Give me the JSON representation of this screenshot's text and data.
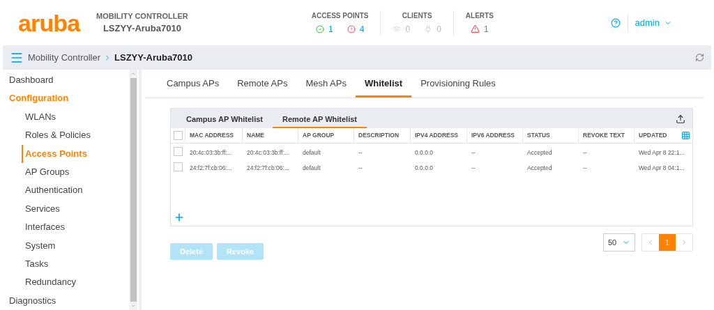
{
  "header": {
    "logo": "aruba",
    "product": "MOBILITY CONTROLLER",
    "device": "LSZYY-Aruba7010",
    "stats": [
      {
        "title": "ACCESS POINTS",
        "items": [
          {
            "kind": "up",
            "value": "1"
          },
          {
            "kind": "down",
            "value": "4"
          }
        ]
      },
      {
        "title": "CLIENTS",
        "items": [
          {
            "kind": "wireless",
            "value": "0"
          },
          {
            "kind": "wired",
            "value": "0"
          }
        ]
      },
      {
        "title": "ALERTS",
        "items": [
          {
            "kind": "alert",
            "value": "1"
          }
        ]
      }
    ],
    "user": "admin"
  },
  "breadcrumb": {
    "parent": "Mobility Controller",
    "current": "LSZYY-Aruba7010"
  },
  "sidebar": {
    "items": [
      {
        "label": "Dashboard",
        "expanded": false
      },
      {
        "label": "Configuration",
        "expanded": true,
        "children": [
          {
            "label": "WLANs",
            "selected": false
          },
          {
            "label": "Roles & Policies",
            "selected": false
          },
          {
            "label": "Access Points",
            "selected": true
          },
          {
            "label": "AP Groups",
            "selected": false
          },
          {
            "label": "Authentication",
            "selected": false
          },
          {
            "label": "Services",
            "selected": false
          },
          {
            "label": "Interfaces",
            "selected": false
          },
          {
            "label": "System",
            "selected": false
          },
          {
            "label": "Tasks",
            "selected": false
          },
          {
            "label": "Redundancy",
            "selected": false
          }
        ]
      },
      {
        "label": "Diagnostics",
        "expanded": false
      }
    ]
  },
  "tabs": [
    {
      "label": "Campus APs",
      "selected": false
    },
    {
      "label": "Remote APs",
      "selected": false
    },
    {
      "label": "Mesh APs",
      "selected": false
    },
    {
      "label": "Whitelist",
      "selected": true
    },
    {
      "label": "Provisioning Rules",
      "selected": false
    }
  ],
  "subtabs": [
    {
      "label": "Campus AP Whitelist",
      "selected": false
    },
    {
      "label": "Remote AP Whitelist",
      "selected": true
    }
  ],
  "table": {
    "columns": [
      "MAC ADDRESS",
      "NAME",
      "AP GROUP",
      "DESCRIPTION",
      "IPV4 ADDRESS",
      "IPV6 ADDRESS",
      "STATUS",
      "REVOKE TEXT",
      "UPDATED"
    ],
    "select_all_checked": false,
    "rows": [
      {
        "checked": false,
        "cells": [
          "20:4c:03:3b:ff:...",
          "20:4c:03:3b:ff:...",
          "default",
          "--",
          "0.0.0.0",
          "--",
          "Accepted",
          "--",
          "Wed Apr 8 22:1..."
        ]
      },
      {
        "checked": false,
        "cells": [
          "24:f2:7f:cb:06:...",
          "24:f2:7f:cb:06:...",
          "default",
          "--",
          "0.0.0.0",
          "--",
          "Accepted",
          "--",
          "Wed Apr 8 04:1..."
        ]
      }
    ]
  },
  "actions": [
    {
      "label": "Delete",
      "disabled": true
    },
    {
      "label": "Revoke",
      "disabled": true
    }
  ],
  "page_size": "50",
  "pages": [
    {
      "label": "1",
      "selected": true
    }
  ]
}
